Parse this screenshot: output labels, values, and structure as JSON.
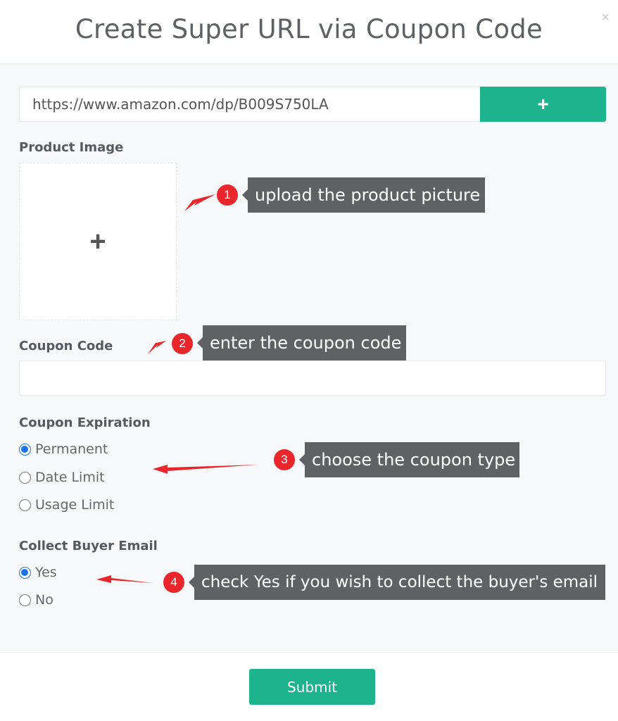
{
  "header": {
    "title": "Create Super URL via Coupon Code",
    "close": "×"
  },
  "url": {
    "value": "https://www.amazon.com/dp/B009S750LA",
    "add_label": "+"
  },
  "product_image": {
    "label": "Product Image",
    "upload_icon": "+"
  },
  "coupon_code": {
    "label": "Coupon Code",
    "value": ""
  },
  "coupon_expiration": {
    "label": "Coupon Expiration",
    "options": [
      "Permanent",
      "Date Limit",
      "Usage Limit"
    ],
    "selected": "Permanent"
  },
  "collect_email": {
    "label": "Collect Buyer Email",
    "options": [
      "Yes",
      "No"
    ],
    "selected": "Yes"
  },
  "submit_label": "Submit",
  "annotations": [
    {
      "number": "1",
      "text": "upload the product picture"
    },
    {
      "number": "2",
      "text": "enter the coupon code"
    },
    {
      "number": "3",
      "text": "choose the coupon type"
    },
    {
      "number": "4",
      "text": "check Yes if you wish to collect the buyer's email"
    }
  ],
  "colors": {
    "accent": "#1db38d",
    "annotation_red": "#e8262b",
    "callout": "#5f6163",
    "radio": "#1a73e8"
  }
}
